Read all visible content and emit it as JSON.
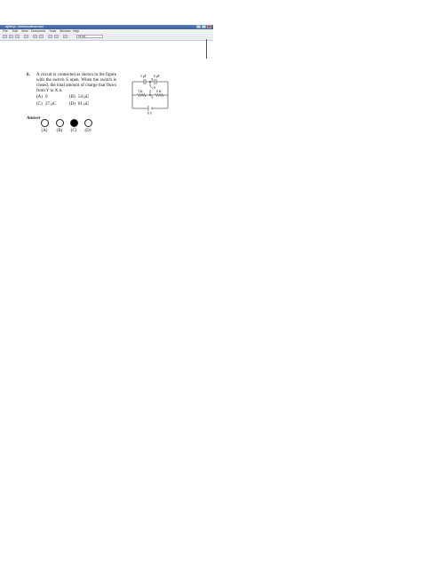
{
  "window": {
    "title": "ajlkfcpr nkkkeaafeamlan",
    "menu": [
      "File",
      "Edit",
      "View",
      "Document",
      "Tools",
      "Window",
      "Help"
    ],
    "zoom": "75.6%"
  },
  "question": {
    "number": "6.",
    "text": "A circuit is connected as shown in the figure with the switch S open. When the switch is closed, the total amount of charge that flows from Y to X is",
    "options": [
      {
        "key": "(A)",
        "value": "0"
      },
      {
        "key": "(B)",
        "value": "54 μC"
      },
      {
        "key": "(C)",
        "value": "27 μC"
      },
      {
        "key": "(D)",
        "value": "81 μC"
      }
    ]
  },
  "circuit": {
    "c1": "3 μF",
    "c2": "6 μF",
    "r1": "3 Ω",
    "r2": "6 Ω",
    "switch": "S",
    "node_x": "X",
    "node_y": "Y",
    "battery": "9 V"
  },
  "answer": {
    "label": "Answer",
    "choices": [
      "(A)",
      "(B)",
      "(C)",
      "(D)"
    ],
    "selected_index": 2
  }
}
